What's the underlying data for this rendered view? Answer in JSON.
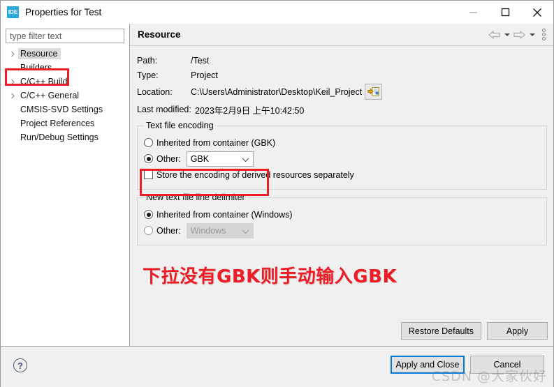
{
  "window": {
    "title": "Properties for Test",
    "app_icon_label": "IDE",
    "controls": {
      "minimize": "minimize-icon",
      "maximize": "maximize-icon",
      "close": "close-icon"
    }
  },
  "sidebar": {
    "filter_placeholder": "type filter text",
    "items": [
      {
        "label": "Resource",
        "expandable": true,
        "selected": true
      },
      {
        "label": "Builders",
        "expandable": false,
        "selected": false
      },
      {
        "label": "C/C++ Build",
        "expandable": true,
        "selected": false
      },
      {
        "label": "C/C++ General",
        "expandable": true,
        "selected": false
      },
      {
        "label": "CMSIS-SVD Settings",
        "expandable": false,
        "selected": false
      },
      {
        "label": "Project References",
        "expandable": false,
        "selected": false
      },
      {
        "label": "Run/Debug Settings",
        "expandable": false,
        "selected": false
      }
    ]
  },
  "panel": {
    "title": "Resource",
    "nav": {
      "back": "back-arrow-icon",
      "back_menu": "chevron-down-icon",
      "forward": "forward-arrow-icon",
      "forward_menu": "chevron-down-icon",
      "view_menu": "view-menu-icon"
    },
    "fields": [
      {
        "label": "Path:",
        "value": "/Test"
      },
      {
        "label": "Type:",
        "value": "Project"
      }
    ],
    "location": {
      "label": "Location:",
      "value": "C:\\Users\\Administrator\\Desktop\\Keil_Project",
      "browse_icon": "open-folder-icon"
    },
    "last_modified": {
      "label": "Last modified:",
      "value": "2023年2月9日 上午10:42:50"
    },
    "encoding_group": {
      "title": "Text file encoding",
      "inherited_label": "Inherited from container (GBK)",
      "inherited_checked": false,
      "other_label": "Other:",
      "other_checked": true,
      "other_value": "GBK",
      "store_derived_label": "Store the encoding of derived resources separately",
      "store_derived_checked": false
    },
    "delimiter_group": {
      "title": "New text file line delimiter",
      "inherited_label": "Inherited from container (Windows)",
      "inherited_checked": true,
      "other_label": "Other:",
      "other_checked": false,
      "other_value": "Windows",
      "other_disabled": true
    },
    "annotation": "下拉没有GBK则手动输入GBK",
    "buttons": {
      "restore_defaults": "Restore Defaults",
      "apply": "Apply"
    }
  },
  "footer": {
    "help_icon": "?",
    "apply_and_close": "Apply and Close",
    "cancel": "Cancel"
  },
  "watermark": "CSDN @大家伙好",
  "colors": {
    "highlight": "#ee1c25",
    "focus_border": "#0078d7",
    "app_icon_bg": "#29a8e0",
    "selection_bg": "#dcdcdc"
  }
}
